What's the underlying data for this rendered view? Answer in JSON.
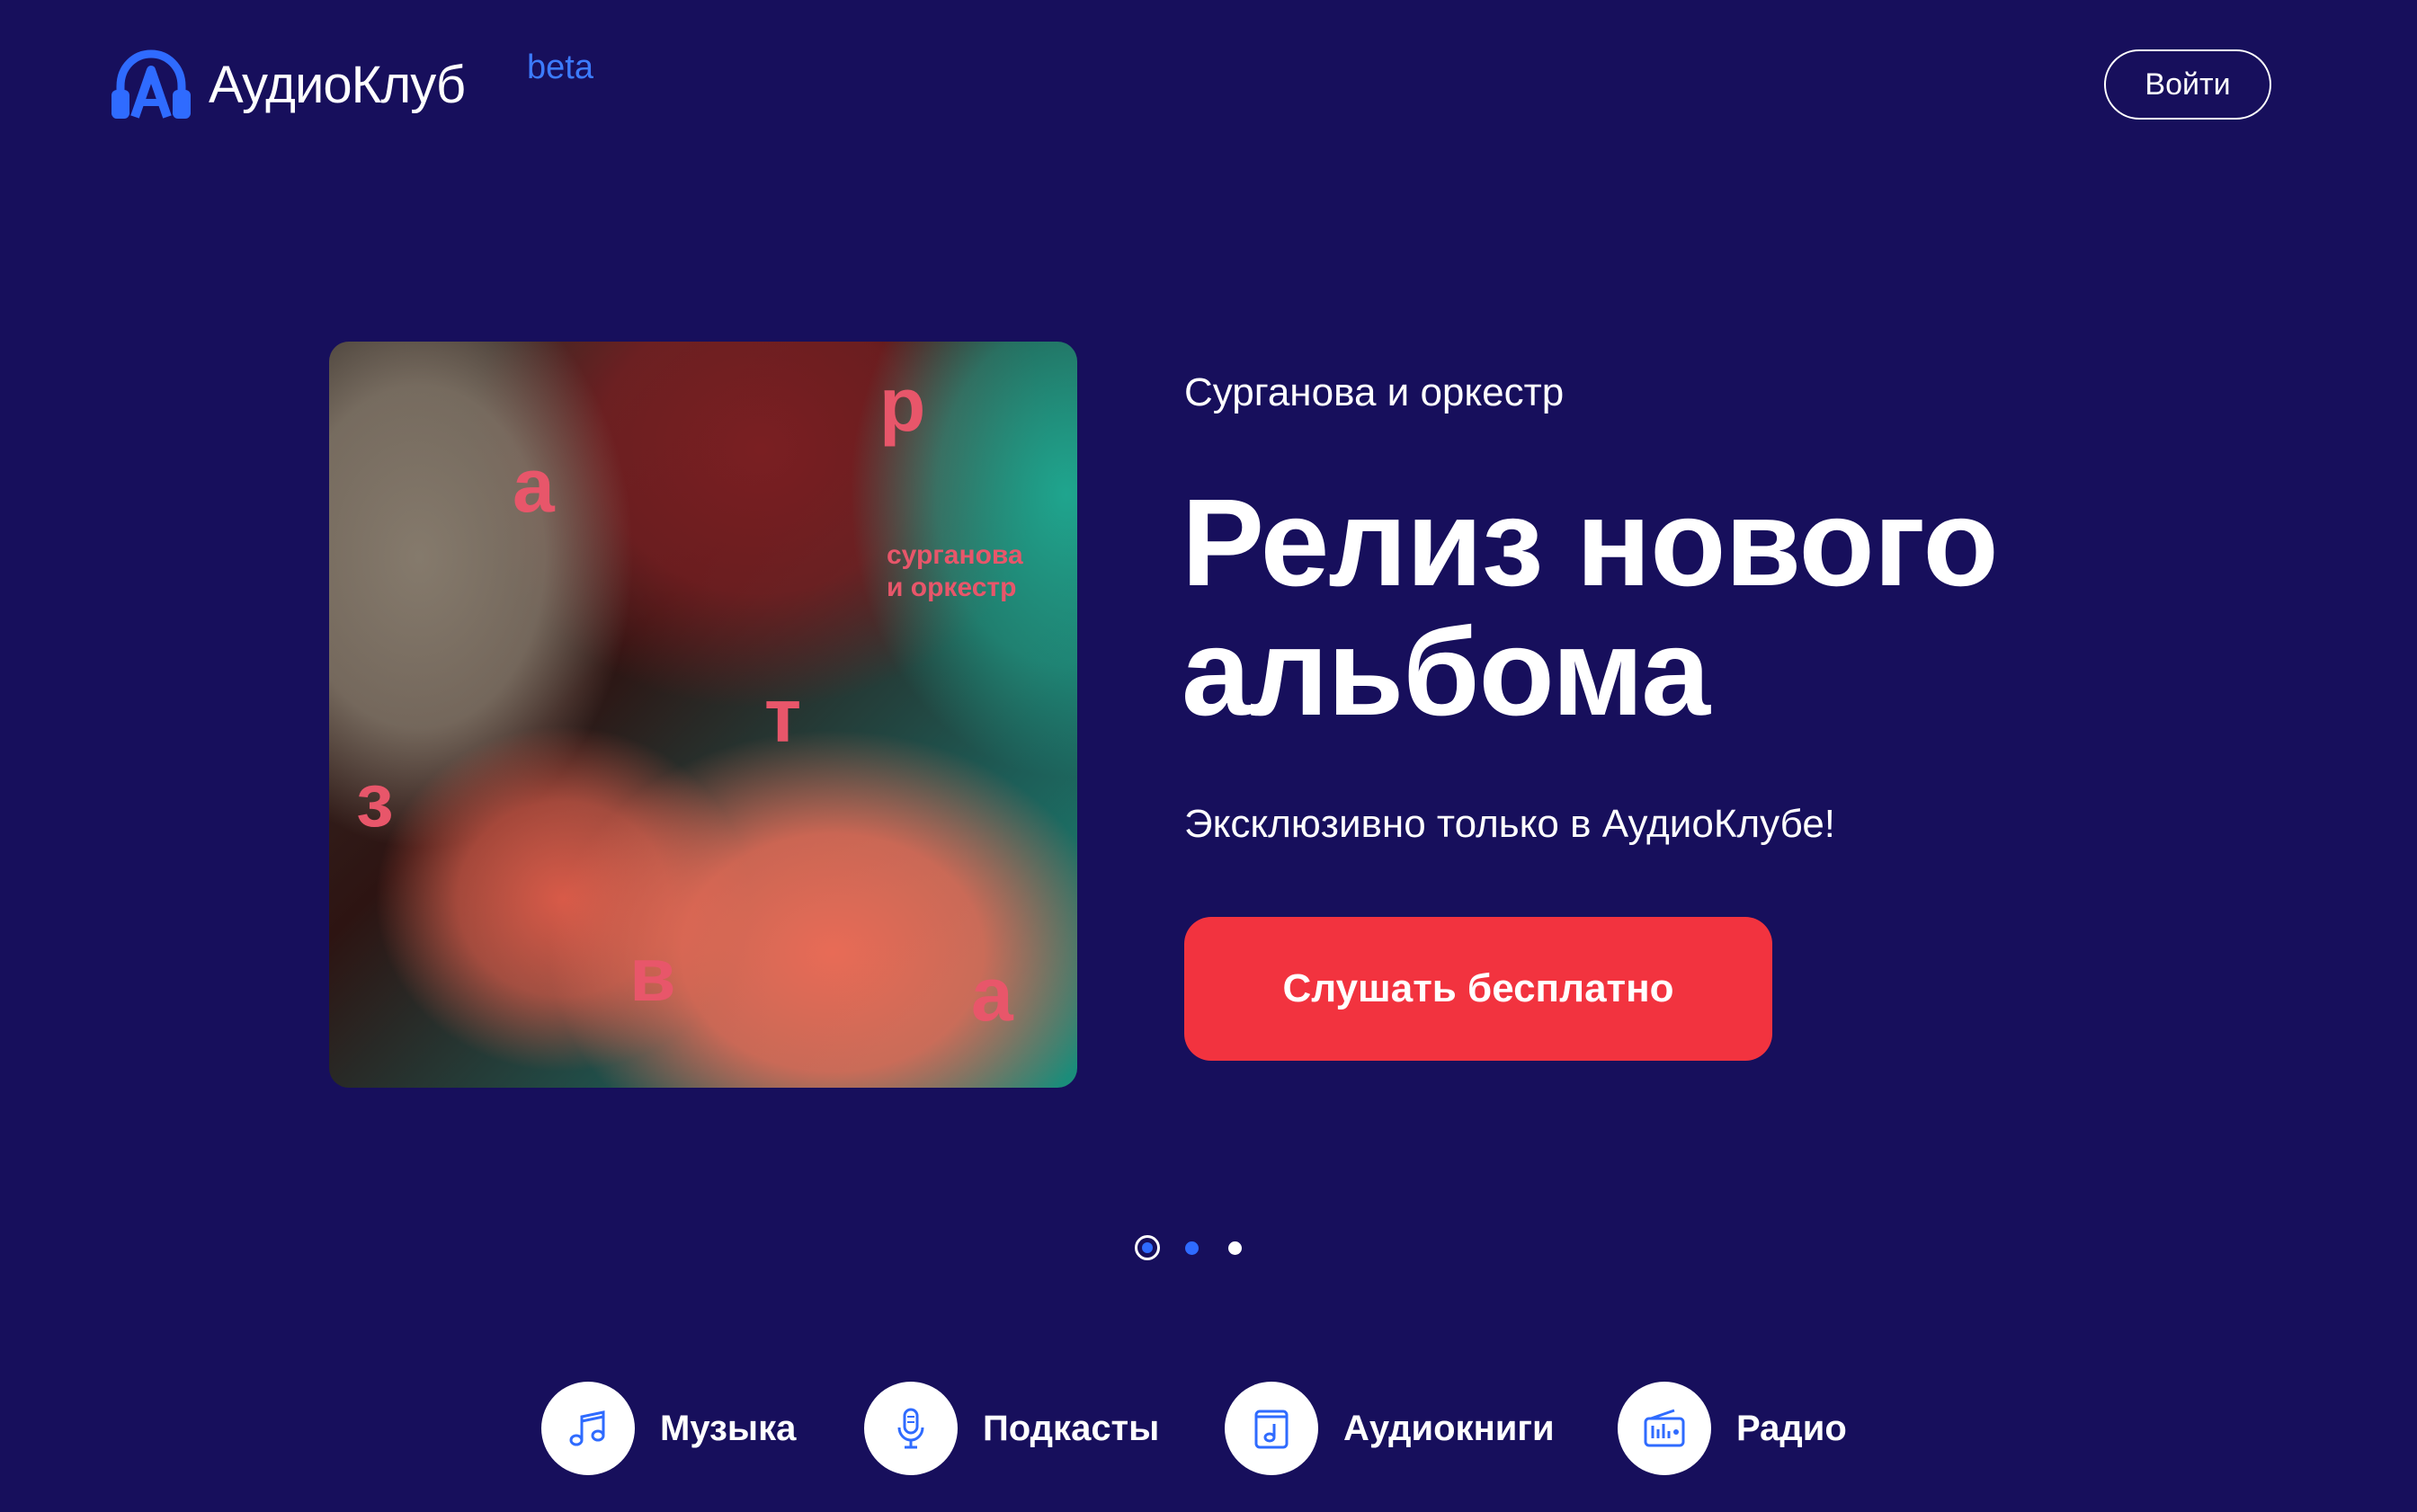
{
  "header": {
    "logo_text": "АудиоКлуб",
    "logo_badge": "beta",
    "login_label": "Войти"
  },
  "hero": {
    "artist": "Сурганова и оркестр",
    "headline": "Релиз нового альбома",
    "subline": "Эксклюзивно только в АудиоКлубе!",
    "cta_label": "Слушать бесплатно",
    "cover": {
      "letters": [
        "р",
        "а",
        "т",
        "з",
        "в",
        "а"
      ],
      "caption_line1": "сурганова",
      "caption_line2": "и оркестр"
    }
  },
  "pager": {
    "total": 3,
    "active": 1
  },
  "categories": [
    {
      "label": "Музыка",
      "icon": "music-note-icon"
    },
    {
      "label": "Подкасты",
      "icon": "microphone-icon"
    },
    {
      "label": "Аудиокниги",
      "icon": "audiobook-icon"
    },
    {
      "label": "Радио",
      "icon": "radio-icon"
    }
  ],
  "colors": {
    "background": "#170f5c",
    "accent_blue": "#2f6bff",
    "cta_red": "#f2333f",
    "cover_letter_pink": "#e8566a"
  }
}
